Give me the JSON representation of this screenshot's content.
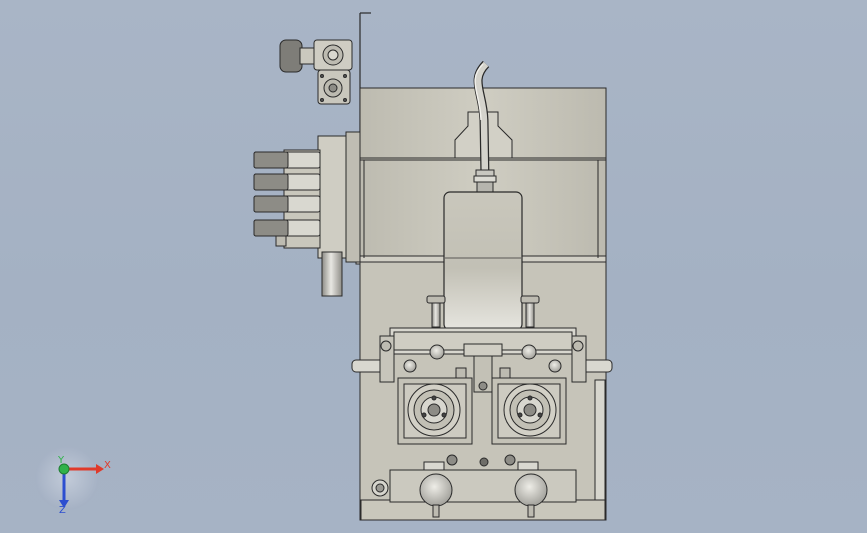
{
  "viewport": {
    "background": "#a7b3c5",
    "body_color": "#c8c6bb",
    "edge_color": "#2a2a2a",
    "metal_color": "#d9d8d0",
    "shadow_color": "#8e8d86"
  },
  "triad": {
    "x_label": "X",
    "y_label": "Y",
    "z_label": "Z",
    "x_color": "#e03a2a",
    "y_color": "#2fb24a",
    "z_color": "#2c4ed0"
  }
}
